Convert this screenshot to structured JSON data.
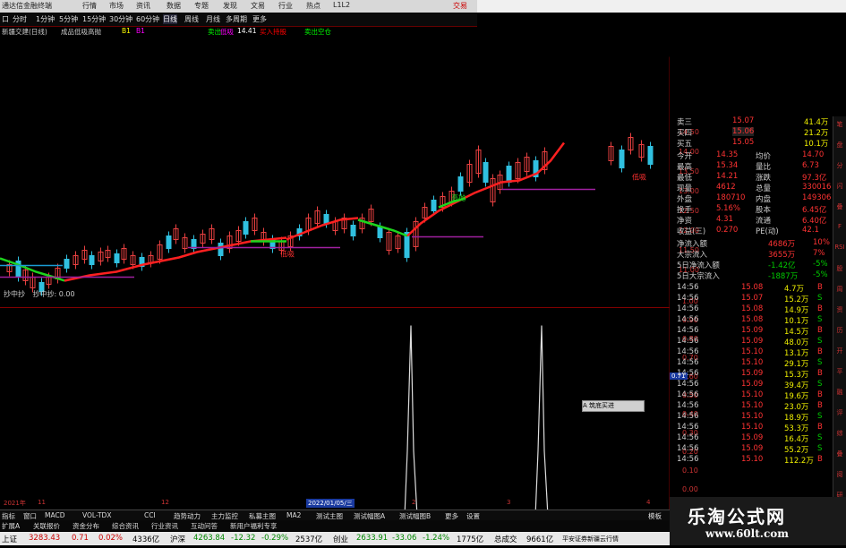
{
  "titlebar": {
    "app_title": "通达信金融终端",
    "menus": [
      "行情",
      "市场",
      "资讯",
      "数据",
      "专题",
      "发现",
      "文易",
      "行业",
      "热点",
      "L1L2"
    ],
    "right_text": "交易"
  },
  "menubar": {
    "items": [
      "口",
      "分时",
      "1分钟",
      "5分钟",
      "15分钟",
      "30分钟",
      "60分钟",
      "日线",
      "周线",
      "月线",
      "多周期",
      "更多"
    ]
  },
  "infobar": {
    "stock": "新疆交建(日线)",
    "indicator": "成品低吸高抛",
    "b1": "B1",
    "b2": "B1",
    "mark1": "卖出",
    "mark2": "低吸",
    "val1": "14.41",
    "mark3": "买入持股",
    "mark4": "卖出空仓"
  },
  "chart_labels": {
    "ann1": "低吸",
    "ann2": "低吸",
    "ann3": "高抛",
    "ann4": "低吸",
    "ann5": "低吸"
  },
  "price_axis": {
    "ticks": [
      "14.50",
      "14.00",
      "13.50",
      "13.00",
      "12.50",
      "12.00",
      "11.50",
      "11.00",
      "10.50"
    ]
  },
  "lower_panel": {
    "title": "抄中抄",
    "title2": "抄中抄: 0.00",
    "ticks": [
      "1.00",
      "0.90",
      "0.80",
      "0.70",
      "0.60",
      "0.50",
      "0.40",
      "0.30",
      "0.20",
      "0.10",
      "0.00"
    ],
    "cursor_value": "0.71"
  },
  "date_bar": {
    "year": "2021年",
    "m1": "11",
    "m2": "12",
    "selected_date": "2022/01/05/三",
    "m3": "2",
    "m4": "3",
    "m5": "4"
  },
  "quote": {
    "ask_rows": [
      {
        "label": "卖三",
        "price": "15.07",
        "vol": "41.4万"
      },
      {
        "label": "买四",
        "price": "15.06",
        "vol": "21.2万"
      },
      {
        "label": "买五",
        "price": "15.05",
        "vol": "10.1万"
      }
    ],
    "stats": [
      {
        "l1": "今开",
        "v1": "14.35",
        "l2": "均价",
        "v2": "14.70"
      },
      {
        "l1": "最高",
        "v1": "15.34",
        "l2": "量比",
        "v2": "6.73"
      },
      {
        "l1": "最低",
        "v1": "14.21",
        "l2": "涨跌",
        "v2": "97.3亿"
      },
      {
        "l1": "现量",
        "v1": "4612",
        "l2": "总量",
        "v2": "330016"
      },
      {
        "l1": "外盘",
        "v1": "180710",
        "l2": "内盘",
        "v2": "149306"
      },
      {
        "l1": "换手",
        "v1": "5.16%",
        "l2": "股本",
        "v2": "6.45亿"
      },
      {
        "l1": "净资",
        "v1": "4.31",
        "l2": "流通",
        "v2": "6.40亿"
      },
      {
        "l1": "收益(三)",
        "v1": "0.270",
        "l2": "PE(动)",
        "v2": "42.1"
      }
    ],
    "flows": [
      {
        "label": "净流入额",
        "val": "4686万",
        "pct": "10%"
      },
      {
        "label": "大宗流入",
        "val": "3655万",
        "pct": "7%"
      },
      {
        "label": "5日净流入额",
        "val": "-1.42亿",
        "pct": "-5%"
      },
      {
        "label": "5日大宗流入",
        "val": "-1887万",
        "pct": "-5%"
      }
    ],
    "ticks": [
      {
        "t": "14:56",
        "p": "15.08",
        "v": "4.7万",
        "d": "B"
      },
      {
        "t": "14:56",
        "p": "15.07",
        "v": "15.2万",
        "d": "S"
      },
      {
        "t": "14:56",
        "p": "15.08",
        "v": "14.9万",
        "d": "B"
      },
      {
        "t": "14:56",
        "p": "15.08",
        "v": "10.1万",
        "d": "S"
      },
      {
        "t": "14:56",
        "p": "15.09",
        "v": "14.5万",
        "d": "B"
      },
      {
        "t": "14:56",
        "p": "15.09",
        "v": "48.0万",
        "d": "S"
      },
      {
        "t": "14:56",
        "p": "15.10",
        "v": "13.1万",
        "d": "B"
      },
      {
        "t": "14:56",
        "p": "15.10",
        "v": "29.1万",
        "d": "S"
      },
      {
        "t": "14:56",
        "p": "15.09",
        "v": "15.3万",
        "d": "B"
      },
      {
        "t": "14:56",
        "p": "15.09",
        "v": "39.4万",
        "d": "S"
      },
      {
        "t": "14:56",
        "p": "15.10",
        "v": "19.6万",
        "d": "B"
      },
      {
        "t": "14:56",
        "p": "15.10",
        "v": "23.0万",
        "d": "B"
      },
      {
        "t": "14:56",
        "p": "15.10",
        "v": "18.9万",
        "d": "S"
      },
      {
        "t": "14:56",
        "p": "15.10",
        "v": "53.3万",
        "d": "B"
      },
      {
        "t": "14:56",
        "p": "15.09",
        "v": "16.4万",
        "d": "S"
      },
      {
        "t": "14:56",
        "p": "15.09",
        "v": "55.2万",
        "d": "S"
      },
      {
        "t": "14:56",
        "p": "15.10",
        "v": "112.2万",
        "d": "B"
      }
    ]
  },
  "popup": {
    "text": "A 筑底买进"
  },
  "tabbar": {
    "items": [
      "指标",
      "窗口",
      "MACD",
      "VOL-TDX",
      "CCI",
      "趋势动力",
      "主力监控",
      "私募主图",
      "MA2",
      "测试主图",
      "测试幅图A",
      "测试幅图B",
      "更多",
      "设置"
    ],
    "right": "模板"
  },
  "tabbar2": {
    "items": [
      "扩展A",
      "关联报价",
      "资金分布",
      "综合资讯",
      "行业资讯",
      "互动问答",
      "新用户福利专享"
    ]
  },
  "statusbar": {
    "sh_label": "上证",
    "sh_val": "3283.43",
    "sh_chg": "0.71",
    "sh_pct": "0.02%",
    "sh_amt": "4336亿",
    "hs_label": "沪深",
    "hs_val": "4263.84",
    "hs_chg": "-12.32",
    "hs_pct": "-0.29%",
    "hs_amt": "2537亿",
    "cy_label": "创业",
    "cy_val": "2633.91",
    "cy_chg": "-33.06",
    "cy_pct": "-1.24%",
    "cy_amt": "1775亿",
    "total_label": "总成交",
    "total_amt": "9661亿",
    "broker": "平安证券新疆云行情"
  },
  "watermark": {
    "main": "乐淘公式网",
    "url": "www.60lt.com"
  },
  "right_toolbar": {
    "items": [
      "笔",
      "盘",
      "分",
      "闪",
      "叠",
      "F",
      "RSI",
      "股",
      "周",
      "资",
      "历",
      "开",
      "平",
      "融",
      "评",
      "综",
      "叠",
      "阅",
      "研"
    ]
  }
}
